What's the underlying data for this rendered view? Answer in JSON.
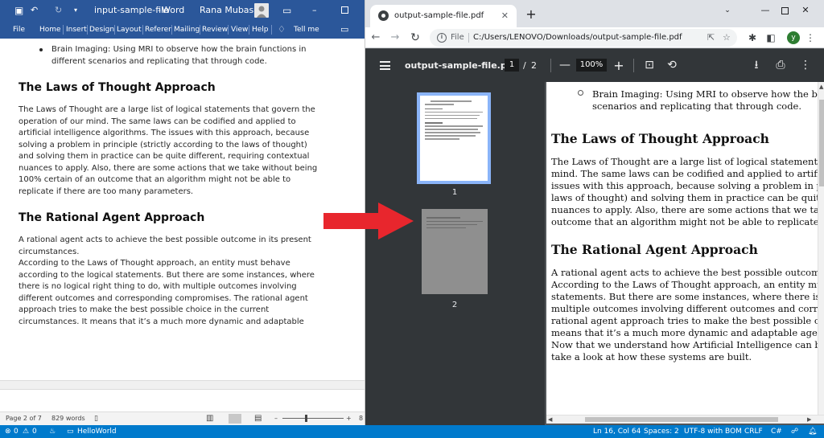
{
  "word": {
    "title": "input-sample-file",
    "app": "Word",
    "user": "Rana Mubashir",
    "ribbon_tabs": [
      "File",
      "Home",
      "Insert",
      "Design",
      "Layout",
      "Referer",
      "Mailing",
      "Review",
      "View",
      "Help"
    ],
    "tell_me": "Tell me",
    "doc": {
      "bullet": "Brain Imaging: Using MRI to observe how the brain functions in different scenarios and replicating that through code.",
      "h1": "The Laws of Thought Approach",
      "p1": "The Laws of Thought are a large list of logical statements that govern the operation of our mind. The same laws can be codified and applied to artificial intelligence algorithms. The issues with this approach, because solving a problem in principle (strictly according to the laws of thought) and solving them in practice can be quite different, requiring contextual nuances to apply. Also, there are some actions that we take without being 100% certain of an outcome that an algorithm might not be able to replicate if there are too many parameters.",
      "h2": "The Rational Agent Approach",
      "p2": "A rational agent acts to achieve the best possible outcome in its present circumstances.",
      "p3": "According to the Laws of Thought approach, an entity must behave according to the logical statements. But there are some instances, where there is no logical right thing to do, with multiple outcomes involving different outcomes and corresponding compromises. The rational agent approach tries to make the best possible choice in the current circumstances. It means that it’s a much more dynamic and adaptable"
    },
    "status": {
      "page": "Page 2 of 7",
      "words": "829 words",
      "zoom_partial": "8"
    }
  },
  "chrome": {
    "tab_title": "output-sample-file.pdf",
    "scheme": "File",
    "url": "C:/Users/LENOVO/Downloads/output-sample-file.pdf",
    "avatar_letter": "y",
    "pdf": {
      "file_name": "output-sample-file.pdf",
      "current_page": "1",
      "page_sep": "/",
      "total_pages": "2",
      "zoom": "100%",
      "thumb_labels": [
        "1",
        "2"
      ],
      "page": {
        "bullet_lines": [
          "Brain Imaging: Using MRI to observe how the brain fun",
          "scenarios and replicating that through code."
        ],
        "h1": "The Laws of Thought Approach",
        "p1_lines": [
          "The Laws of Thought are a large list of logical statements that gov",
          "mind. The same laws can be codified and applied to artificial intel",
          "issues with this approach, because solving a problem in principle (",
          "laws of thought) and solving them in practice can be quite differen",
          "nuances to apply. Also, there are some actions that we take withou",
          "outcome that an algorithm might not be able to replicate if there ar"
        ],
        "h2": "The Rational Agent Approach",
        "p2_lines": [
          "A rational agent acts to achieve the best possible outcome in its pr",
          "According to the Laws of Thought approach, an entity must behav",
          "statements. But there are some instances, where there is no logical",
          "multiple outcomes involving different outcomes and correspondin",
          "rational agent approach tries to make the best possible choice in th",
          "means that it’s a much more dynamic and adaptable agent.",
          "Now that we understand how Artificial Intelligence can be designe",
          "take a look at how these systems are built."
        ]
      }
    }
  },
  "vscode_status": {
    "problems": "0",
    "warnings": "0",
    "project": "HelloWorld",
    "position": "Ln 16, Col 64",
    "spaces": "Spaces: 2",
    "encoding": "UTF-8 with BOM",
    "eol": "CRLF",
    "language": "C#"
  },
  "colors": {
    "word_blue": "#2b579a",
    "chrome_pdf_dark": "#323639",
    "vscode_blue": "#007acc",
    "arrow_red": "#e8262d"
  }
}
